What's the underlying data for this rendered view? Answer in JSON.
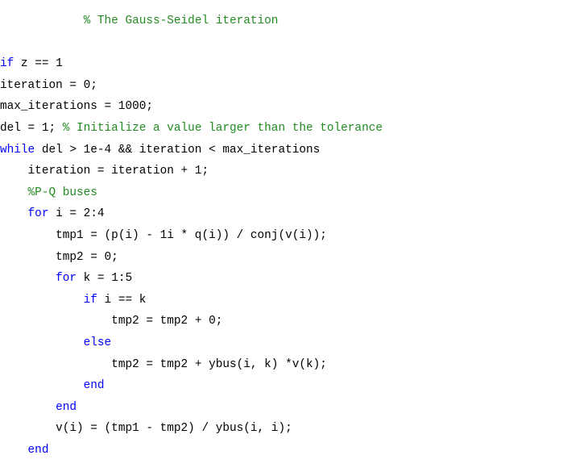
{
  "code_lines": [
    {
      "indent": "            ",
      "segments": [
        {
          "type": "comment",
          "text": "% The Gauss-Seidel iteration"
        }
      ]
    },
    {
      "indent": "",
      "segments": []
    },
    {
      "indent": "",
      "segments": [
        {
          "type": "keyword",
          "text": "if"
        },
        {
          "type": "plain",
          "text": " z == 1"
        }
      ]
    },
    {
      "indent": "",
      "segments": [
        {
          "type": "plain",
          "text": "iteration = 0;"
        }
      ]
    },
    {
      "indent": "",
      "segments": [
        {
          "type": "plain",
          "text": "max_iterations = 1000;"
        }
      ]
    },
    {
      "indent": "",
      "segments": [
        {
          "type": "plain",
          "text": "del = 1; "
        },
        {
          "type": "comment",
          "text": "% Initialize a value larger than the tolerance"
        }
      ]
    },
    {
      "indent": "",
      "segments": [
        {
          "type": "keyword",
          "text": "while"
        },
        {
          "type": "plain",
          "text": " del > 1e-4 && iteration < max_iterations"
        }
      ]
    },
    {
      "indent": "    ",
      "segments": [
        {
          "type": "plain",
          "text": "iteration = iteration + 1;"
        }
      ]
    },
    {
      "indent": "    ",
      "segments": [
        {
          "type": "comment",
          "text": "%P-Q buses"
        }
      ]
    },
    {
      "indent": "    ",
      "segments": [
        {
          "type": "keyword",
          "text": "for"
        },
        {
          "type": "plain",
          "text": " i = 2:4"
        }
      ]
    },
    {
      "indent": "        ",
      "segments": [
        {
          "type": "plain",
          "text": "tmp1 = (p(i) - 1i * q(i)) / conj(v(i));"
        }
      ]
    },
    {
      "indent": "        ",
      "segments": [
        {
          "type": "plain",
          "text": "tmp2 = 0;"
        }
      ]
    },
    {
      "indent": "        ",
      "segments": [
        {
          "type": "keyword",
          "text": "for"
        },
        {
          "type": "plain",
          "text": " k = 1:5"
        }
      ]
    },
    {
      "indent": "            ",
      "segments": [
        {
          "type": "keyword",
          "text": "if"
        },
        {
          "type": "plain",
          "text": " i == k"
        }
      ]
    },
    {
      "indent": "                ",
      "segments": [
        {
          "type": "plain",
          "text": "tmp2 = tmp2 + 0;"
        }
      ]
    },
    {
      "indent": "            ",
      "segments": [
        {
          "type": "keyword",
          "text": "else"
        }
      ]
    },
    {
      "indent": "                ",
      "segments": [
        {
          "type": "plain",
          "text": "tmp2 = tmp2 + ybus(i, k) *v(k);"
        }
      ]
    },
    {
      "indent": "            ",
      "segments": [
        {
          "type": "keyword",
          "text": "end"
        }
      ]
    },
    {
      "indent": "        ",
      "segments": [
        {
          "type": "keyword",
          "text": "end"
        }
      ]
    },
    {
      "indent": "        ",
      "segments": [
        {
          "type": "plain",
          "text": "v(i) = (tmp1 - tmp2) / ybus(i, i);"
        }
      ]
    },
    {
      "indent": "    ",
      "segments": [
        {
          "type": "keyword",
          "text": "end"
        }
      ]
    }
  ],
  "colors": {
    "keyword": "#0000ff",
    "comment": "#228b22",
    "plain": "#000000",
    "background": "#ffffff"
  }
}
